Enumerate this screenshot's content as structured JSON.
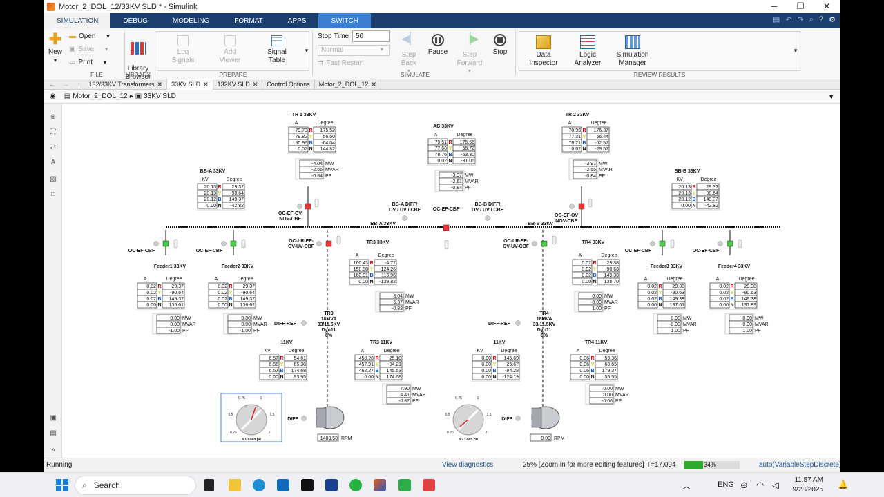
{
  "window": {
    "title": "Motor_2_DOL_12/33KV SLD * - Simulink",
    "controls": [
      "─",
      "❐",
      "✕"
    ]
  },
  "ribbon_tabs": [
    "SIMULATION",
    "DEBUG",
    "MODELING",
    "FORMAT",
    "APPS",
    "SWITCH"
  ],
  "ribbon": {
    "file": {
      "new": "New",
      "open": "Open",
      "save": "Save",
      "print": "Print",
      "label": "FILE"
    },
    "library": {
      "browser": "Library\nBrowser",
      "label": "LIBRARY"
    },
    "prepare": {
      "log": "Log\nSignals",
      "add": "Add\nViewer",
      "signal": "Signal\nTable",
      "label": "PREPARE"
    },
    "simulate": {
      "stop_time_label": "Stop Time",
      "stop_time": "50",
      "mode": "Normal",
      "fast": "Fast Restart",
      "step_back": "Step\nBack",
      "pause": "Pause",
      "step_fwd": "Step\nForward",
      "stop": "Stop",
      "label": "SIMULATE"
    },
    "review": {
      "data": "Data\nInspector",
      "logic": "Logic\nAnalyzer",
      "sim": "Simulation\nManager",
      "label": "REVIEW RESULTS"
    }
  },
  "doc_tabs": [
    "132/33KV Transformers",
    "33KV SLD",
    "132KV SLD",
    "Control Options",
    "Motor_2_DOL_12"
  ],
  "breadcrumb": [
    "Motor_2_DOL_12",
    "33KV SLD"
  ],
  "sld": {
    "tr1": {
      "title": "TR 1 33KV",
      "A": [
        "79.73",
        "79.82",
        "80.96",
        "0.02"
      ],
      "D": [
        "175.52",
        "56.50",
        "-64.04",
        "144.82"
      ],
      "P": [
        "-4.04",
        "-2.66",
        "-0.84"
      ]
    },
    "ab": {
      "title": "AB 33KV",
      "A": [
        "79.51",
        "77.68",
        "78.76",
        "0.02"
      ],
      "D": [
        "175.66",
        "55.72",
        "-63.30",
        "-31.05"
      ],
      "P": [
        "-3.97",
        "-2.61",
        "-0.84"
      ]
    },
    "tr2": {
      "title": "TR 2 33KV",
      "A": [
        "78.93",
        "77.31",
        "78.21",
        "0.02"
      ],
      "D": [
        "176.37",
        "56.44",
        "-62.57",
        "-29.57"
      ],
      "P": [
        "-3.97",
        "-2.55",
        "-0.84"
      ]
    },
    "bba": {
      "title": "BB-A 33KV",
      "K": [
        "20.13",
        "20.13",
        "20.12",
        "0.00"
      ],
      "D": [
        "29.37",
        "-90.64",
        "149.37",
        "-42.82"
      ]
    },
    "bbb": {
      "title": "BB-B 33KV",
      "K": [
        "20.13",
        "20.13",
        "20.12",
        "0.00"
      ],
      "D": [
        "29.37",
        "-90.64",
        "149.37",
        "-42.82"
      ]
    },
    "f1": {
      "title": "Feeder1 33KV",
      "A": [
        "0.02",
        "0.02",
        "0.02",
        "0.00"
      ],
      "D": [
        "29.37",
        "-90.64",
        "149.37",
        "136.61"
      ],
      "P": [
        "0.00",
        "0.00",
        "-1.00"
      ]
    },
    "f2": {
      "title": "Feeder2 33KV",
      "A": [
        "0.02",
        "0.02",
        "0.02",
        "0.00"
      ],
      "D": [
        "29.37",
        "-90.64",
        "149.37",
        "136.62"
      ],
      "P": [
        "0.00",
        "0.00",
        "-1.00"
      ]
    },
    "tr3": {
      "title": "TR3 33KV",
      "A": [
        "160.43",
        "158.88",
        "160.91",
        "0.00"
      ],
      "D": [
        "-4.77",
        "-124.26",
        "115.96",
        "-139.82"
      ],
      "P": [
        "8.04",
        "5.37",
        "-0.83"
      ]
    },
    "tr4": {
      "title": "TR4 33KV",
      "A": [
        "0.02",
        "0.02",
        "0.02",
        "0.00"
      ],
      "D": [
        "29.38",
        "-90.63",
        "149.38",
        "138.70"
      ],
      "P": [
        "0.00",
        "-0.00",
        "1.00"
      ]
    },
    "f3": {
      "title": "Feeder3 33KV",
      "A": [
        "0.02",
        "0.02",
        "0.02",
        "0.00"
      ],
      "D": [
        "29.38",
        "-90.63",
        "149.38",
        "137.61"
      ],
      "P": [
        "0.00",
        "-0.00",
        "1.00"
      ]
    },
    "f4": {
      "title": "Feeder4 33KV",
      "A": [
        "0.02",
        "0.02",
        "0.02",
        "0.00"
      ],
      "D": [
        "29.38",
        "-90.63",
        "149.38",
        "137.89"
      ],
      "P": [
        "0.00",
        "-0.00",
        "1.00"
      ]
    },
    "kv11a": {
      "title": "11KV",
      "K": [
        "6.57",
        "6.56",
        "6.57",
        "0.00"
      ],
      "D": [
        "54.61",
        "-65.38",
        "174.68",
        "93.95"
      ]
    },
    "tr3lv": {
      "title": "TR3 11KV",
      "A": [
        "458.28",
        "457.91",
        "462.27",
        "0.00"
      ],
      "D": [
        "25.18",
        "-94.21",
        "145.53",
        "174.68"
      ],
      "P": [
        "7.90",
        "4.41",
        "-0.87"
      ]
    },
    "kv11b": {
      "title": "11KV",
      "K": [
        "0.00",
        "0.00",
        "0.00",
        "0.00"
      ],
      "D": [
        "145.69",
        "25.67",
        "-94.28",
        "-124.19"
      ]
    },
    "tr4lv": {
      "title": "TR4 11KV",
      "A": [
        "0.06",
        "0.06",
        "0.06",
        "0.00"
      ],
      "D": [
        "59.36",
        "-60.65",
        "179.37",
        "55.55"
      ],
      "P": [
        "0.00",
        "0.00",
        "-0.06"
      ]
    },
    "tr3spec": [
      "TR3",
      "18MVA",
      "33/11.5KV",
      "Dyn11",
      "8%"
    ],
    "tr4spec": [
      "TR4",
      "18MVA",
      "33/11.5KV",
      "Dyn11",
      "8%"
    ],
    "rpm1": "1483.58",
    "rpm2": "0.00",
    "rpm_unit": "RPM",
    "bus_a": "BB-A 33KV",
    "bus_b": "BB-B 33KV",
    "labels": {
      "ocefov": "OC-EF-OV\nNOV-CBF",
      "ocef": "OC-EF-CBF",
      "oclr": "OC-LR-EF-\nOV-UV-CBF",
      "bbadiff": "BB-A DIFF/\nOV / UV / CBF",
      "bbbdiff": "BB-B DIFF/\nOV / UV / CBF",
      "diffref": "DIFF-REF",
      "diff": "DIFF",
      "m1": "M1 Load pu",
      "m2": "M2 Load pu"
    },
    "hdr": {
      "A": "A",
      "KV": "KV",
      "Deg": "Degree",
      "phases": [
        "R",
        "Y",
        "B",
        "N"
      ],
      "units": [
        "MW",
        "MVAR",
        "PF"
      ]
    },
    "dial_ticks": [
      "0.25",
      "0.5",
      "0.75",
      "1",
      "1.5",
      "2"
    ]
  },
  "status": {
    "state": "Running",
    "diag": "View diagnostics",
    "zoom": "25% [Zoom in for more editing features]",
    "time": "T=17.094",
    "progress": 0.34,
    "progress_text": "34%",
    "solver": "auto(VariableStepDiscrete)"
  },
  "taskbar": {
    "search": "Search",
    "lang": "ENG",
    "time": "11:57 AM",
    "date": "9/28/2025"
  }
}
